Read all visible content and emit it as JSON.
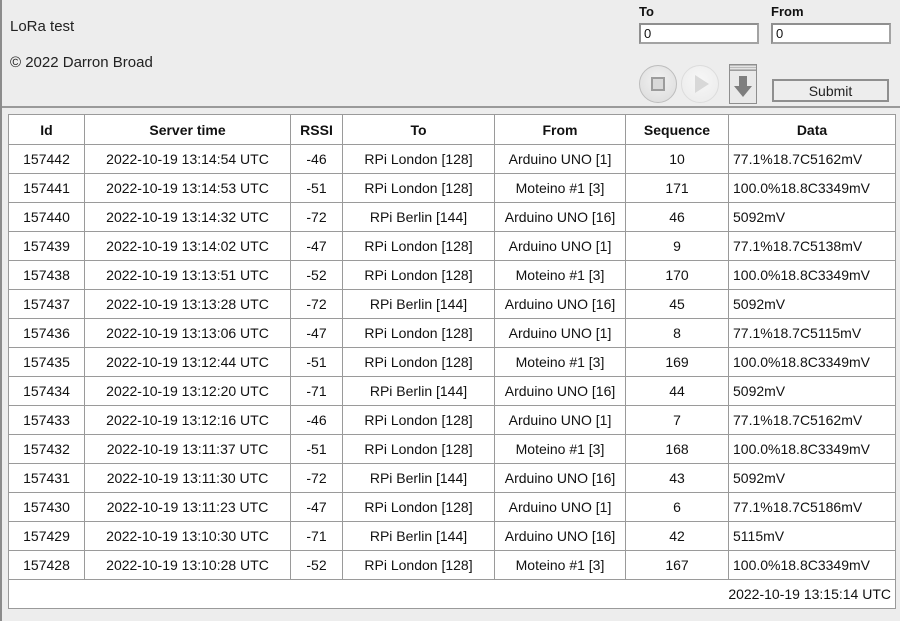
{
  "header": {
    "app_title": "LoRa test",
    "copyright": "© 2022 Darron Broad",
    "to_label": "To",
    "to_value": "0",
    "from_label": "From",
    "from_value": "0",
    "submit_label": "Submit",
    "stop_button_name": "stop-icon",
    "play_button_name": "play-icon",
    "download_button_name": "download-icon"
  },
  "table": {
    "columns": [
      "Id",
      "Server time",
      "RSSI",
      "To",
      "From",
      "Sequence",
      "Data"
    ],
    "rows": [
      [
        "157442",
        "2022-10-19 13:14:54 UTC",
        "-46",
        "RPi London [128]",
        "Arduino UNO [1]",
        "10",
        "77.1%18.7C5162mV"
      ],
      [
        "157441",
        "2022-10-19 13:14:53 UTC",
        "-51",
        "RPi London [128]",
        "Moteino #1 [3]",
        "171",
        "100.0%18.8C3349mV"
      ],
      [
        "157440",
        "2022-10-19 13:14:32 UTC",
        "-72",
        "RPi Berlin [144]",
        "Arduino UNO [16]",
        "46",
        "5092mV"
      ],
      [
        "157439",
        "2022-10-19 13:14:02 UTC",
        "-47",
        "RPi London [128]",
        "Arduino UNO [1]",
        "9",
        "77.1%18.7C5138mV"
      ],
      [
        "157438",
        "2022-10-19 13:13:51 UTC",
        "-52",
        "RPi London [128]",
        "Moteino #1 [3]",
        "170",
        "100.0%18.8C3349mV"
      ],
      [
        "157437",
        "2022-10-19 13:13:28 UTC",
        "-72",
        "RPi Berlin [144]",
        "Arduino UNO [16]",
        "45",
        "5092mV"
      ],
      [
        "157436",
        "2022-10-19 13:13:06 UTC",
        "-47",
        "RPi London [128]",
        "Arduino UNO [1]",
        "8",
        "77.1%18.7C5115mV"
      ],
      [
        "157435",
        "2022-10-19 13:12:44 UTC",
        "-51",
        "RPi London [128]",
        "Moteino #1 [3]",
        "169",
        "100.0%18.8C3349mV"
      ],
      [
        "157434",
        "2022-10-19 13:12:20 UTC",
        "-71",
        "RPi Berlin [144]",
        "Arduino UNO [16]",
        "44",
        "5092mV"
      ],
      [
        "157433",
        "2022-10-19 13:12:16 UTC",
        "-46",
        "RPi London [128]",
        "Arduino UNO [1]",
        "7",
        "77.1%18.7C5162mV"
      ],
      [
        "157432",
        "2022-10-19 13:11:37 UTC",
        "-51",
        "RPi London [128]",
        "Moteino #1 [3]",
        "168",
        "100.0%18.8C3349mV"
      ],
      [
        "157431",
        "2022-10-19 13:11:30 UTC",
        "-72",
        "RPi Berlin [144]",
        "Arduino UNO [16]",
        "43",
        "5092mV"
      ],
      [
        "157430",
        "2022-10-19 13:11:23 UTC",
        "-47",
        "RPi London [128]",
        "Arduino UNO [1]",
        "6",
        "77.1%18.7C5186mV"
      ],
      [
        "157429",
        "2022-10-19 13:10:30 UTC",
        "-71",
        "RPi Berlin [144]",
        "Arduino UNO [16]",
        "42",
        "5115mV"
      ],
      [
        "157428",
        "2022-10-19 13:10:28 UTC",
        "-52",
        "RPi London [128]",
        "Moteino #1 [3]",
        "167",
        "100.0%18.8C3349mV"
      ]
    ],
    "footer_timestamp": "2022-10-19 13:15:14 UTC"
  },
  "colors": {
    "page_background": "#ededed",
    "table_background": "#ffffff",
    "border": "#9a9a9a",
    "text": "#111111"
  }
}
